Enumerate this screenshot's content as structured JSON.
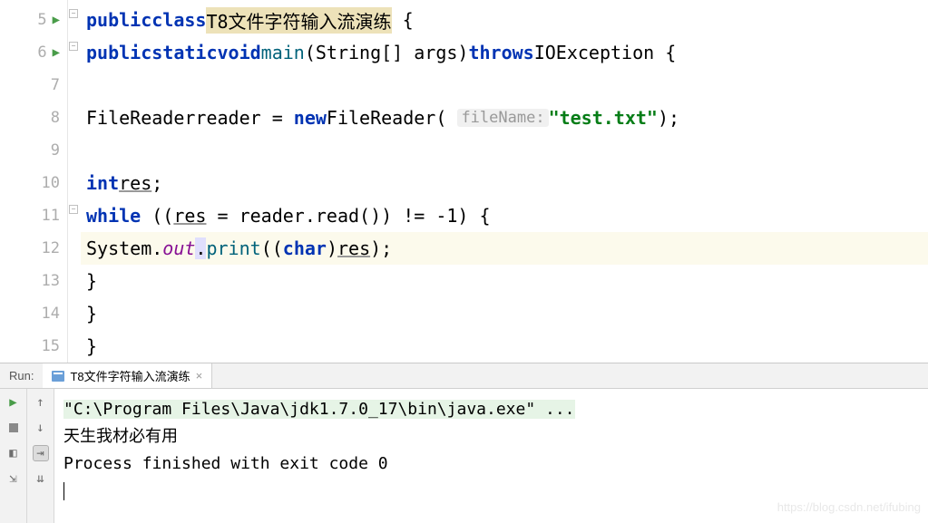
{
  "editor": {
    "lines": [
      {
        "num": "5",
        "runnable": true
      },
      {
        "num": "6",
        "runnable": true
      },
      {
        "num": "7",
        "runnable": false
      },
      {
        "num": "8",
        "runnable": false
      },
      {
        "num": "9",
        "runnable": false
      },
      {
        "num": "10",
        "runnable": false
      },
      {
        "num": "11",
        "runnable": false
      },
      {
        "num": "12",
        "runnable": false,
        "highlighted": true
      },
      {
        "num": "13",
        "runnable": false
      },
      {
        "num": "14",
        "runnable": false
      },
      {
        "num": "15",
        "runnable": false
      }
    ],
    "tokens": {
      "public": "public",
      "class": "class",
      "className": "T8文件字符输入流演练",
      "static": "static",
      "void": "void",
      "main": "main",
      "stringArr": "(String[] args)",
      "throws": "throws",
      "ioexception": "IOException",
      "fileReader": "FileReader",
      "reader": "reader",
      "eq": " = ",
      "new": "new",
      "hint": "fileName:",
      "testTxt": "\"test.txt\"",
      "int": "int",
      "res": "res",
      "while": "while",
      "readCall": " = reader.read()) != -1) {",
      "system": "System",
      "out": "out",
      "print": "print",
      "char": "char",
      "openBrace": " {",
      "closeBrace": "}",
      "semi": ";",
      "dot": ".",
      "openParen2": " ((",
      "openParen1": "(("
    }
  },
  "run": {
    "label": "Run:",
    "tabName": "T8文件字符输入流演练",
    "console": {
      "cmd": "\"C:\\Program Files\\Java\\jdk1.7.0_17\\bin\\java.exe\" ...",
      "output1": "天生我材必有用",
      "exit": "Process finished with exit code 0"
    }
  },
  "watermark": "https://blog.csdn.net/ifubing"
}
